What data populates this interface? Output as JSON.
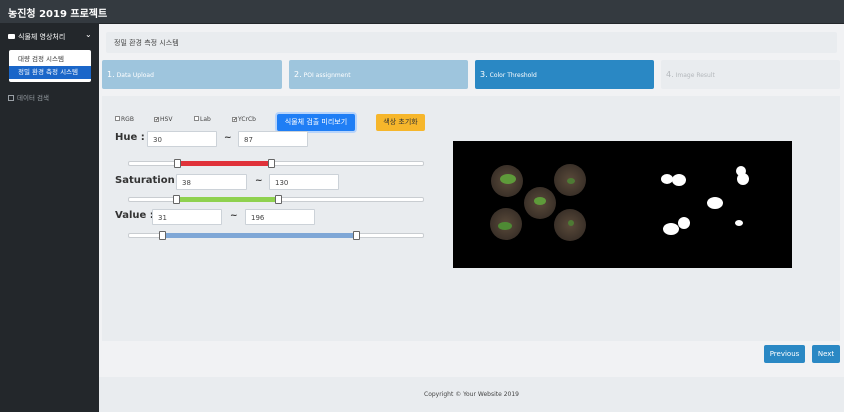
{
  "app": {
    "title": "농진청 2019 프로젝트"
  },
  "sidebar": {
    "section_label": "식물체 영상처리",
    "submenu": [
      "대량 검정 시스템",
      "정밀 환경 측정 시스템"
    ],
    "other_item": "데이터 검색"
  },
  "breadcrumb": "정밀 환경 측정 시스템",
  "steps": [
    {
      "num": "1.",
      "label": "Data Upload"
    },
    {
      "num": "2.",
      "label": "POI assignment"
    },
    {
      "num": "3.",
      "label": "Color Threshold"
    },
    {
      "num": "4.",
      "label": "Image Result"
    }
  ],
  "color_spaces": [
    {
      "label": "RGB",
      "checked": false
    },
    {
      "label": "HSV",
      "checked": true
    },
    {
      "label": "Lab",
      "checked": false
    },
    {
      "label": "YCrCb",
      "checked": true
    }
  ],
  "buttons": {
    "preview": "식물체 검출 미리보기",
    "reset": "색상 초기화",
    "previous": "Previous",
    "next": "Next"
  },
  "thresholds": {
    "hue": {
      "label": "Hue :",
      "min": "30",
      "max": "87",
      "tilde": "~"
    },
    "saturation": {
      "label": "Saturation :",
      "min": "38",
      "max": "130",
      "tilde": "~"
    },
    "value": {
      "label": "Value :",
      "min": "31",
      "max": "196",
      "tilde": "~"
    }
  },
  "colors": {
    "hue_fill": "#e0323a",
    "saturation_fill": "#8fd14f",
    "value_fill": "#7fa7d6",
    "active_step": "#2a88c4"
  },
  "footer": "Copyright © Your Website 2019"
}
